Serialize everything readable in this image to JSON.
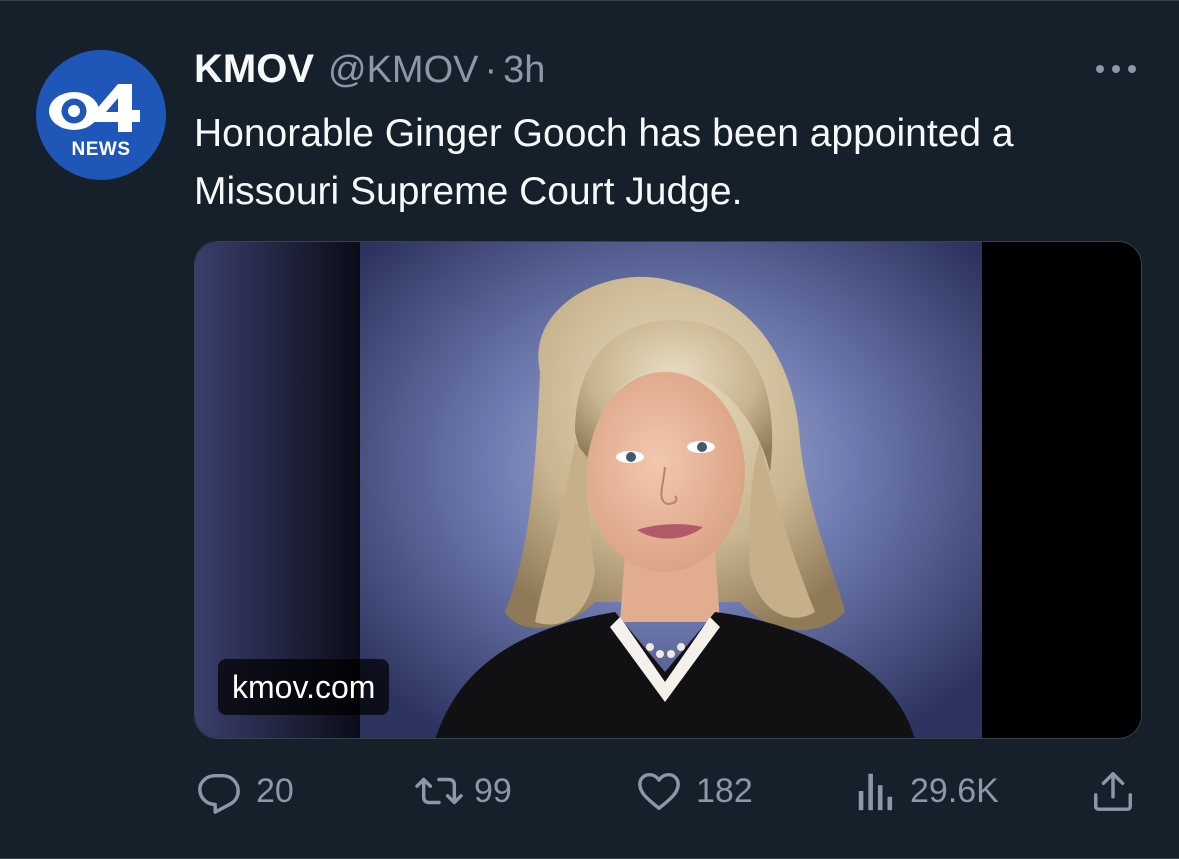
{
  "account": {
    "display_name": "KMOV",
    "handle": "@KMOV",
    "separator": "·",
    "time": "3h",
    "avatar_logo": "cbs-4-news-logo",
    "avatar_caption": "NEWS"
  },
  "tweet": {
    "text": "Honorable Ginger Gooch has been appointed a Missouri Supreme Court Judge."
  },
  "media": {
    "description_icon": "portrait-photo",
    "link_label": "kmov.com"
  },
  "actions": {
    "replies": "20",
    "retweets": "99",
    "likes": "182",
    "views": "29.6K",
    "icons": [
      "reply-icon",
      "retweet-icon",
      "like-icon",
      "views-icon",
      "share-icon"
    ]
  },
  "colors": {
    "background": "#15202b",
    "text_primary": "#f7f9f9",
    "text_secondary": "#8b98a5",
    "avatar_blue": "#1f57b8"
  }
}
